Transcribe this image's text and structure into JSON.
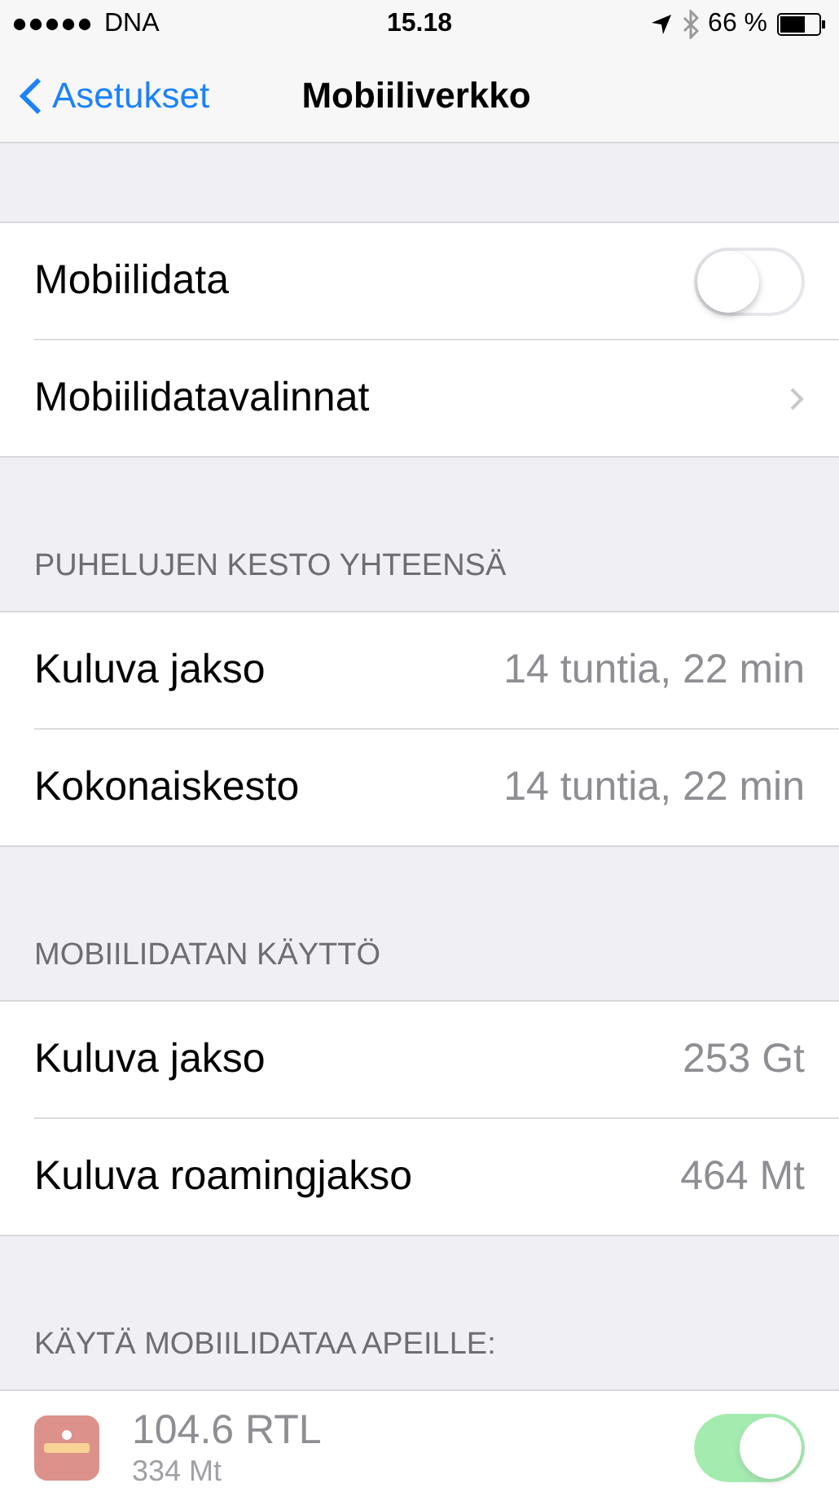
{
  "status_bar": {
    "carrier": "DNA",
    "time": "15.18",
    "battery": "66 %"
  },
  "nav": {
    "back": "Asetukset",
    "title": "Mobiiliverkko"
  },
  "top_rows": [
    {
      "kind": "toggle",
      "label": "Mobiilidata",
      "on": false
    },
    {
      "kind": "link",
      "label": "Mobiilidatavalinnat"
    }
  ],
  "sections": [
    {
      "header": "PUHELUJEN KESTO YHTEENSÄ",
      "rows": [
        {
          "label": "Kuluva jakso",
          "value": "14 tuntia, 22 min"
        },
        {
          "label": "Kokonaiskesto",
          "value": "14 tuntia, 22 min"
        }
      ]
    },
    {
      "header": "MOBIILIDATAN KÄYTTÖ",
      "rows": [
        {
          "label": "Kuluva jakso",
          "value": "253 Gt"
        },
        {
          "label": "Kuluva roamingjakso",
          "value": "464 Mt"
        }
      ]
    }
  ],
  "apps": {
    "header": "KÄYTÄ MOBIILIDATAA APEILLE:",
    "items": [
      {
        "name": "104.6 RTL",
        "usage": "334 Mt",
        "on": true,
        "disabled": true
      }
    ]
  }
}
